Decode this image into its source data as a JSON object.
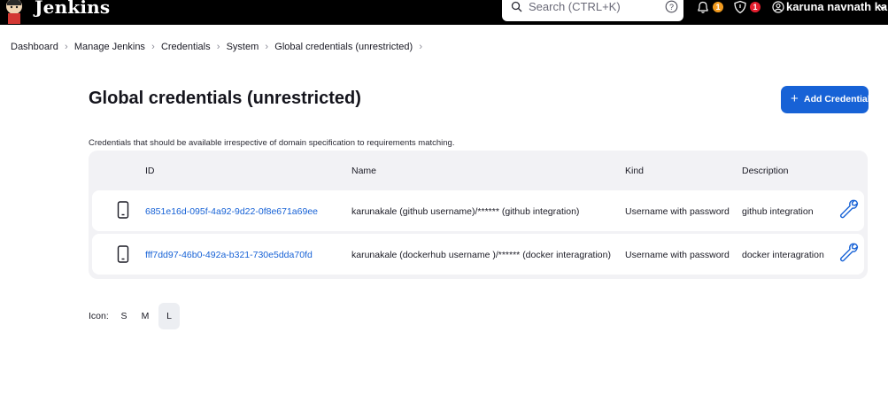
{
  "header": {
    "brand": "Jenkins",
    "search_placeholder": "Search (CTRL+K)",
    "notifications_count": "1",
    "security_count": "1",
    "user_name": "karuna navnath kale"
  },
  "breadcrumb": [
    "Dashboard",
    "Manage Jenkins",
    "Credentials",
    "System",
    "Global credentials (unrestricted)"
  ],
  "page": {
    "title": "Global credentials (unrestricted)",
    "add_button": "Add Credentials",
    "description": "Credentials that should be available irrespective of domain specification to requirements matching."
  },
  "table": {
    "headers": {
      "id": "ID",
      "name": "Name",
      "kind": "Kind",
      "description": "Description"
    },
    "rows": [
      {
        "id": "6851e16d-095f-4a92-9d22-0f8e671a69ee",
        "name": "karunakale (github username)/****** (github integration)",
        "kind": "Username with password",
        "description": "github integration"
      },
      {
        "id": "fff7dd97-46b0-492a-b321-730e5dda70fd",
        "name": "karunakale (dockerhub username )/****** (docker interagration)",
        "kind": "Username with password",
        "description": "docker interagration"
      }
    ]
  },
  "icon_size": {
    "label": "Icon:",
    "options": [
      "S",
      "M",
      "L"
    ],
    "selected": "L"
  },
  "colors": {
    "header_bg": "#000000",
    "accent": "#1762d6",
    "table_bg": "#f2f2f5",
    "badge_orange": "#f29b1f",
    "badge_red": "#e61f2f"
  }
}
